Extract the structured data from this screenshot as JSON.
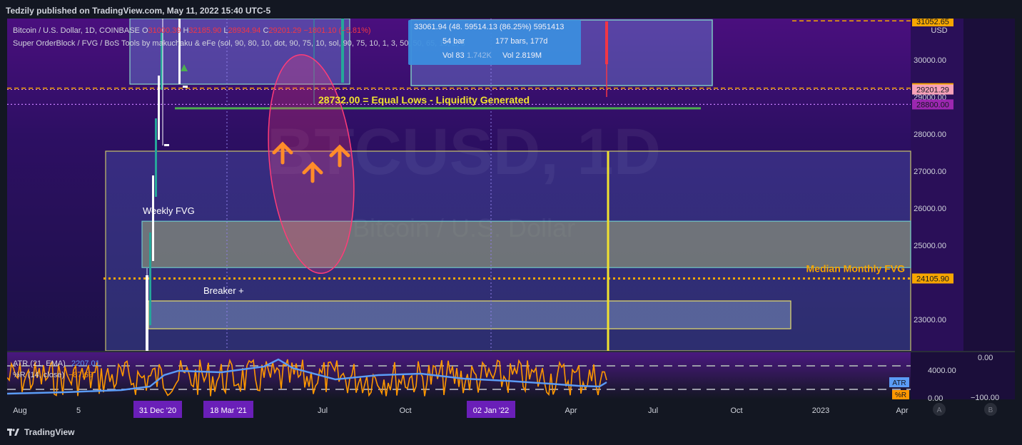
{
  "header": {
    "publish_line": "Tedzily published on TradingView.com, May 11, 2022 15:40 UTC-5"
  },
  "legend": {
    "symbol": "Bitcoin / U.S. Dollar, 1D, COINBASE",
    "open_label": "O",
    "open_value": "31000.39",
    "high_label": "H",
    "high_value": "32185.90",
    "low_label": "L",
    "low_value": "28934.94",
    "close_label": "C",
    "close_value": "29201.29",
    "change": "−1801.10 (−5.81%)",
    "indicator": "Super OrderBlock / FVG / BoS Tools by makuchaku & eFe (sol, 90, 80, 10, dot, 90, 75, 10, sol, 90, 75, 10, 1, 3, 50, 50, 65, 10, 2, 3"
  },
  "measure_tooltip": {
    "line1": "33061.94 (48.  59514.13 (86.25%) 5951413",
    "line2_left": "54 bar",
    "line2_right": "177 bars, 177d",
    "line3_left": "Vol 83",
    "line3_mid": "1.742K",
    "line3_right": "Vol 2.819M"
  },
  "watermark": {
    "ticker": "BTCUSD, 1D",
    "name": "Bitcoin / U.S. Dollar"
  },
  "annotations": {
    "equal_lows": "28732.00 = Equal Lows - Liquidity Generated",
    "weekly_fvg": "Weekly FVG",
    "median_monthly_fvg": "Median Monthly FVG",
    "breaker": "Breaker +"
  },
  "price_axis": {
    "currency": "USD",
    "ticks": [
      "30000.00",
      "29000.00",
      "28000.00",
      "27000.00",
      "26000.00",
      "25000.00",
      "23000.00"
    ],
    "badges": [
      {
        "label": "31052.65",
        "color": "#f7a600"
      },
      {
        "label": "29238.45",
        "color": "#f7a600"
      },
      {
        "label": "29201.29",
        "color": "#f7a1b9"
      },
      {
        "label": "28800.00",
        "color": "#9c27b0"
      },
      {
        "label": "24105.90",
        "color": "#f7a600"
      }
    ]
  },
  "oscillator": {
    "atr_label": "ATR (21, EMA)",
    "atr_value": "2207.01",
    "wr_label": "%R (14, close)",
    "wr_value": "−87.69",
    "left_ticks": [
      "4000.00",
      "0.00"
    ],
    "right_ticks": [
      "0.00",
      "−100.00"
    ],
    "atr_badge": "ATR",
    "wr_badge": "%R"
  },
  "time_axis": {
    "ticks": [
      "Aug",
      "5",
      "Jul",
      "Oct",
      "Apr",
      "Jul",
      "Oct",
      "2023",
      "Apr"
    ],
    "highlights": [
      "31 Dec '20",
      "18 Mar '21",
      "02 Jan '22"
    ],
    "btn_a": "A",
    "btn_b": "B"
  },
  "footer": {
    "brand": "TradingView"
  },
  "chart_data": {
    "type": "line",
    "title": "Bitcoin / U.S. Dollar, 1D, COINBASE",
    "xlabel": "",
    "ylabel": "USD",
    "ylim": [
      22000,
      31300
    ],
    "horizontal_levels": [
      {
        "value": 31052.65,
        "name": "31052.65"
      },
      {
        "value": 29238.45,
        "name": "29238.45"
      },
      {
        "value": 29201.29,
        "name": "29201.29"
      },
      {
        "value": 28800.0,
        "name": "28800.00"
      },
      {
        "value": 28732.0,
        "name": "28732.00 = Equal Lows - Liquidity Generated"
      },
      {
        "value": 24105.9,
        "name": "Median Monthly FVG"
      }
    ],
    "zones": [
      {
        "name": "Weekly FVG",
        "low": 24400,
        "high": 25650
      },
      {
        "name": "Breaker +",
        "low": 22750,
        "high": 23500
      }
    ],
    "oscillator": {
      "atr_value": 2207.01,
      "wr_value": -87.69
    },
    "grid": false,
    "legend": "top-left"
  },
  "colors": {
    "bg_purple": "#2a0f58",
    "accent_orange": "#f7a600",
    "yellow": "#f1e230",
    "green": "#4caf50",
    "pink": "#f7a1b9",
    "purple_badge": "#9c27b0",
    "atr_blue": "#5b9cf6",
    "wr_orange": "#ff9800",
    "tooltip_blue": "#3b8fe0"
  }
}
